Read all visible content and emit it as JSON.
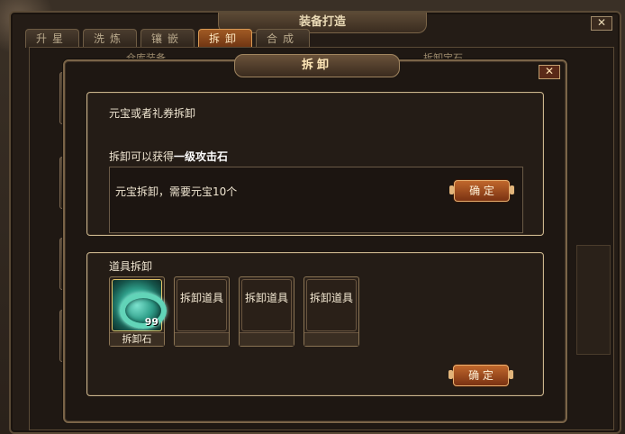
{
  "background_window": {
    "title": "装备打造",
    "close_label": "✕",
    "tabs": [
      {
        "label": "升星",
        "active": false
      },
      {
        "label": "洗炼",
        "active": false
      },
      {
        "label": "镶嵌",
        "active": false
      },
      {
        "label": "拆卸",
        "active": true
      },
      {
        "label": "合成",
        "active": false
      }
    ],
    "left_section_label": "仓库装备",
    "right_section_label": "拆卸宝石"
  },
  "dialog": {
    "title": "拆卸",
    "close_label": "✕",
    "gold_panel": {
      "heading": "元宝或者礼券拆卸",
      "reward_prefix": "拆卸可以获得",
      "reward_item": "一级攻击石",
      "cost_text": "元宝拆卸，需要元宝10个",
      "confirm_label": "确 定"
    },
    "item_panel": {
      "heading": "道具拆卸",
      "slots": [
        {
          "face_text": "",
          "name": "拆卸石",
          "count": "99",
          "filled": true
        },
        {
          "face_text": "拆卸道具",
          "name": "",
          "filled": false
        },
        {
          "face_text": "拆卸道具",
          "name": "",
          "filled": false
        },
        {
          "face_text": "拆卸道具",
          "name": "",
          "filled": false
        }
      ],
      "confirm_label": "确 定"
    }
  }
}
